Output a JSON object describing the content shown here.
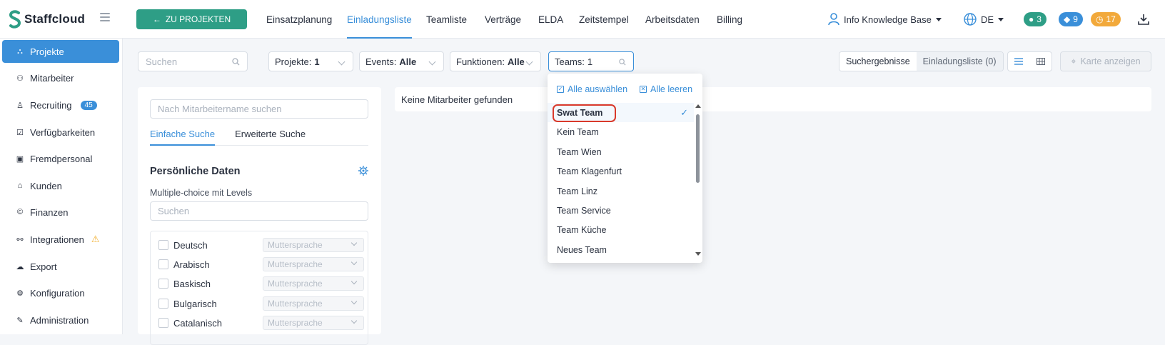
{
  "colors": {
    "accent": "#3a8fd9",
    "brand_green": "#2e9e86",
    "chat": "#2e9e86",
    "bell": "#3a8fd9",
    "clock": "#f2a93b",
    "warning": "#f2b134",
    "highlight": "#d9392b"
  },
  "header": {
    "logo_text": "Staffcloud",
    "back_button": "ZU PROJEKTEN",
    "nav": [
      {
        "label": "Einsatzplanung",
        "active": false
      },
      {
        "label": "Einladungsliste",
        "active": true
      },
      {
        "label": "Teamliste",
        "active": false
      },
      {
        "label": "Verträge",
        "active": false
      },
      {
        "label": "ELDA",
        "active": false
      },
      {
        "label": "Zeitstempel",
        "active": false
      },
      {
        "label": "Arbeitsdaten",
        "active": false
      },
      {
        "label": "Billing",
        "active": false
      }
    ],
    "user": "Info Knowledge Base",
    "language": "DE",
    "counters": {
      "chat": "3",
      "notifications": "9",
      "clock": "17"
    }
  },
  "sidebar": {
    "items": [
      {
        "label": "Projekte",
        "icon": "sitemap-icon"
      },
      {
        "label": "Mitarbeiter",
        "icon": "users-icon"
      },
      {
        "label": "Recruiting",
        "icon": "user-icon",
        "badge": "45"
      },
      {
        "label": "Verfügbarkeiten",
        "icon": "calendar-check-icon"
      },
      {
        "label": "Fremdpersonal",
        "icon": "id-card-icon"
      },
      {
        "label": "Kunden",
        "icon": "bank-icon"
      },
      {
        "label": "Finanzen",
        "icon": "money-icon"
      },
      {
        "label": "Integrationen",
        "icon": "link-icon"
      },
      {
        "label": "Export",
        "icon": "cloud-upload-icon"
      },
      {
        "label": "Konfiguration",
        "icon": "gear-icon"
      },
      {
        "label": "Administration",
        "icon": "wrench-icon"
      }
    ]
  },
  "toolbar": {
    "search_placeholder": "Suchen",
    "filters": {
      "projekte_label": "Projekte:",
      "projekte_value": "1",
      "events_label": "Events:",
      "events_value": "Alle",
      "funktionen_label": "Funktionen:",
      "funktionen_value": "Alle",
      "teams_label": "Teams:",
      "teams_value": "1"
    },
    "results_tab": "Suchergebnisse",
    "invite_tab": "Einladungsliste (0)",
    "map_button": "Karte anzeigen"
  },
  "left_panel": {
    "search_placeholder": "Nach Mitarbeitername suchen",
    "tab_simple": "Einfache Suche",
    "tab_advanced": "Erweiterte Suche",
    "section_title": "Persönliche Daten",
    "mc_label": "Multiple-choice mit Levels",
    "mc_search_placeholder": "Suchen",
    "languages": [
      {
        "name": "Deutsch",
        "level": "Muttersprache"
      },
      {
        "name": "Arabisch",
        "level": "Muttersprache"
      },
      {
        "name": "Baskisch",
        "level": "Muttersprache"
      },
      {
        "name": "Bulgarisch",
        "level": "Muttersprache"
      },
      {
        "name": "Catalanisch",
        "level": "Muttersprache"
      }
    ]
  },
  "results": {
    "empty_message": "Keine Mitarbeiter gefunden"
  },
  "teams_dropdown": {
    "select_all": "Alle auswählen",
    "clear_all": "Alle leeren",
    "options": [
      {
        "label": "Swat Team",
        "selected": true
      },
      {
        "label": "Kein Team",
        "selected": false
      },
      {
        "label": "Team Wien",
        "selected": false
      },
      {
        "label": "Team Klagenfurt",
        "selected": false
      },
      {
        "label": "Team Linz",
        "selected": false
      },
      {
        "label": "Team Service",
        "selected": false
      },
      {
        "label": "Team Küche",
        "selected": false
      },
      {
        "label": "Neues Team",
        "selected": false
      }
    ]
  }
}
